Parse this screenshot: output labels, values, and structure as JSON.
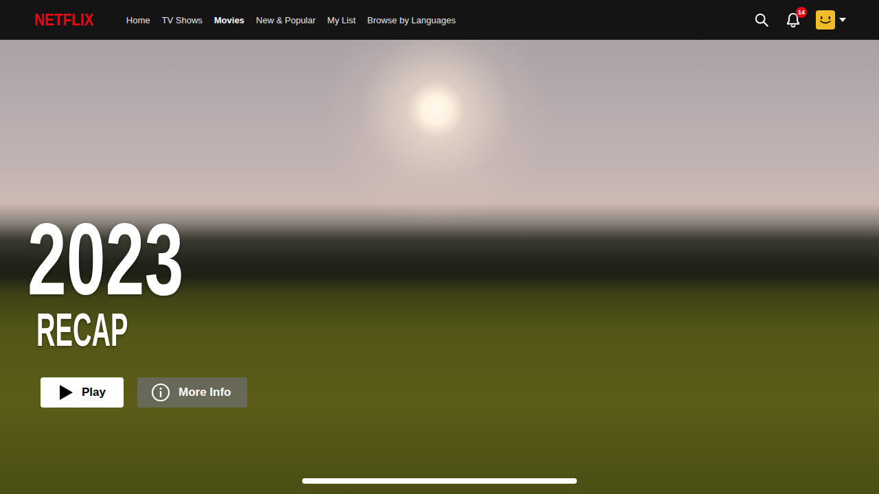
{
  "nav": {
    "logo": "NETFLIX",
    "links": [
      {
        "label": "Home",
        "selected": false
      },
      {
        "label": "TV Shows",
        "selected": false
      },
      {
        "label": "Movies",
        "selected": true
      },
      {
        "label": "New & Popular",
        "selected": false
      },
      {
        "label": "My List",
        "selected": false
      },
      {
        "label": "Browse by Languages",
        "selected": false
      }
    ]
  },
  "notifications": {
    "count": "14"
  },
  "hero": {
    "title": "2023",
    "subtitle": "RECAP",
    "buttons": [
      {
        "label": "Play",
        "kind": "play"
      },
      {
        "label": "More Info",
        "kind": "info"
      }
    ]
  }
}
